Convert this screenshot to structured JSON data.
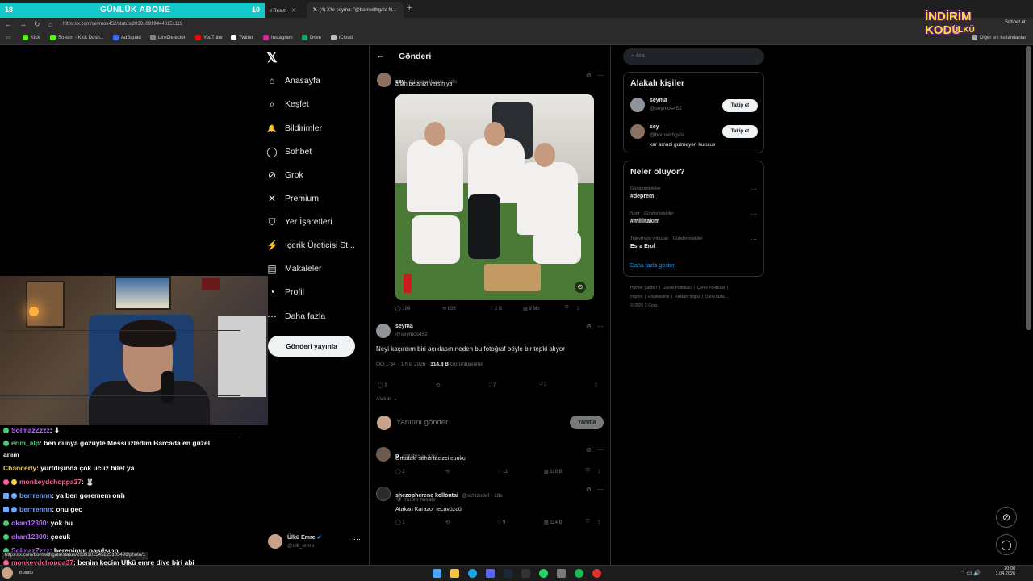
{
  "browser": {
    "tabs": [
      {
        "label": "li Resim"
      },
      {
        "label": "(4) X'te seyma: \"@bornwithgala N..."
      }
    ],
    "url": "https://x.com/seymos452/status/2039109194440151119",
    "bookmarks": [
      "Kick",
      "Stream - Kick Dash...",
      "AdSquad",
      "LinkDetector",
      "YouTube",
      "Twitter",
      "Instagram",
      "Drive",
      "iCloud"
    ],
    "bookmarks_right": "Diğer sık kullanılanlar",
    "chat_label": "Sohbet et"
  },
  "overlay": {
    "left_num": "18",
    "title": "GÜNLÜK ABONE",
    "right_num": "10",
    "promo1": "İNDİRİM KODU",
    "promo2": "ÜLKÜ"
  },
  "sidebar": {
    "items": [
      {
        "label": "Anasayfa",
        "icon": "⌂"
      },
      {
        "label": "Keşfet",
        "icon": "⌕"
      },
      {
        "label": "Bildirimler",
        "icon": "🔔"
      },
      {
        "label": "Sohbet",
        "icon": "◯"
      },
      {
        "label": "Grok",
        "icon": "⊘"
      },
      {
        "label": "Premium",
        "icon": "✕"
      },
      {
        "label": "Yer İşaretleri",
        "icon": "⛉"
      },
      {
        "label": "İçerik Üreticisi St...",
        "icon": "⚡"
      },
      {
        "label": "Makaleler",
        "icon": "▤"
      },
      {
        "label": "Profil",
        "icon": "◔"
      },
      {
        "label": "Daha fazla",
        "icon": "⋯"
      }
    ],
    "post_button": "Gönderi yayınla",
    "account": {
      "name": "Ülkü Emre",
      "handle": "@ulk_emre"
    }
  },
  "main": {
    "header": "Gönderi",
    "quoted": {
      "name": "sey",
      "handle": "@bornwithgala · 18s",
      "text": "allah belanizi versin ya",
      "stats": {
        "replies": "199",
        "reposts": "856",
        "likes": "2 B",
        "views": "9 Mn"
      }
    },
    "post": {
      "name": "seyma",
      "handle": "@seymos452",
      "text": "Neyi kaçırdım biri açıklasın neden bu fotoğraf böyle bir tepki alıyor",
      "time": "ÖÖ 1:34 · 1 Nis 2026 ·",
      "views_count": "314,8 B",
      "views_label": "Görüntülenme",
      "stats": {
        "replies": "3",
        "likes": "7",
        "bookmarks": "3"
      },
      "sort": "Alakalı"
    },
    "reply_box": {
      "placeholder": "Yanıtını gönder",
      "button": "Yanıtla"
    },
    "replies": [
      {
        "name": "p",
        "handle": "@zshr5a · 18s",
        "text": "Ortadaki sahis tacizci cunku",
        "sub": "",
        "stats": {
          "replies": "2",
          "reposts": "",
          "likes": "11",
          "views": "119 B"
        }
      },
      {
        "name": "shezopherene kollontai",
        "handle": "@schizodef · 18s",
        "sub": "Yorum hesabı",
        "text": "Atakan Karazor tecavüzcü",
        "stats": {
          "replies": "1",
          "reposts": "",
          "likes": "9",
          "views": "114 B"
        }
      }
    ]
  },
  "right": {
    "search_placeholder": "Ara",
    "relevant_title": "Alakalı kişiler",
    "people": [
      {
        "name": "seyma",
        "handle": "@seymos452",
        "bio": "",
        "button": "Takip et"
      },
      {
        "name": "sey",
        "handle": "@bornwithgala",
        "bio": "kar amaci gutmeyen kurulus",
        "button": "Takip et"
      }
    ],
    "trends_title": "Neler oluyor?",
    "trends": [
      {
        "category": "Gündemdekiler",
        "name": "#deprem"
      },
      {
        "category": "Spor · Gündemdekiler",
        "name": "#millitakım"
      },
      {
        "category": "Televizyon yıldızları · Gündemdekiler",
        "name": "Esra Erol"
      }
    ],
    "show_more": "Daha fazla göster",
    "footer": [
      "Hizmet Şartları",
      "Gizlilik Politikası",
      "Çerez Politikası",
      "Imprint",
      "Erişilebilirlik",
      "Reklam bilgisi",
      "Daha fazla ...",
      "© 2026 X Corp."
    ]
  },
  "chat": {
    "messages": [
      {
        "user": "SolmazZzzz",
        "color": "#b36cff",
        "text": ": ⬇"
      },
      {
        "user": "erim_alp",
        "color": "#4ec97a",
        "text": ": ben dünya gözüyle Messi izledim Barcada en güzel"
      },
      {
        "user": "",
        "color": "#ffffff",
        "text": "anım"
      },
      {
        "user": "Chancerly",
        "color": "#f5d23c",
        "text": ": yurtdışında çok ucuz bilet ya"
      },
      {
        "user": "monkeydchoppa37",
        "color": "#ff5fa0",
        "text": ":"
      },
      {
        "user": "berrrennn",
        "color": "#6fa8ff",
        "text": ": ya ben goremem onh"
      },
      {
        "user": "berrrennn",
        "color": "#6fa8ff",
        "text": ": onu gec"
      },
      {
        "user": "okan12300",
        "color": "#b36cff",
        "text": ": yok bu"
      },
      {
        "user": "okan12300",
        "color": "#b36cff",
        "text": ": çocuk"
      },
      {
        "user": "SolmazZzzz",
        "color": "#b36cff",
        "text": ": berenimm nasılsınn"
      },
      {
        "user": "monkeydchoppa37",
        "color": "#ff5fa0",
        "text": ": benim keçim Ülkü emre diye biri abi"
      }
    ]
  },
  "status_bar_url": "https://x.com/bornwithgala/status/2039101545225105496/photo/1",
  "taskbar": {
    "time": "20:00",
    "date": "1.04.2026",
    "weather": "Bulutlu"
  }
}
